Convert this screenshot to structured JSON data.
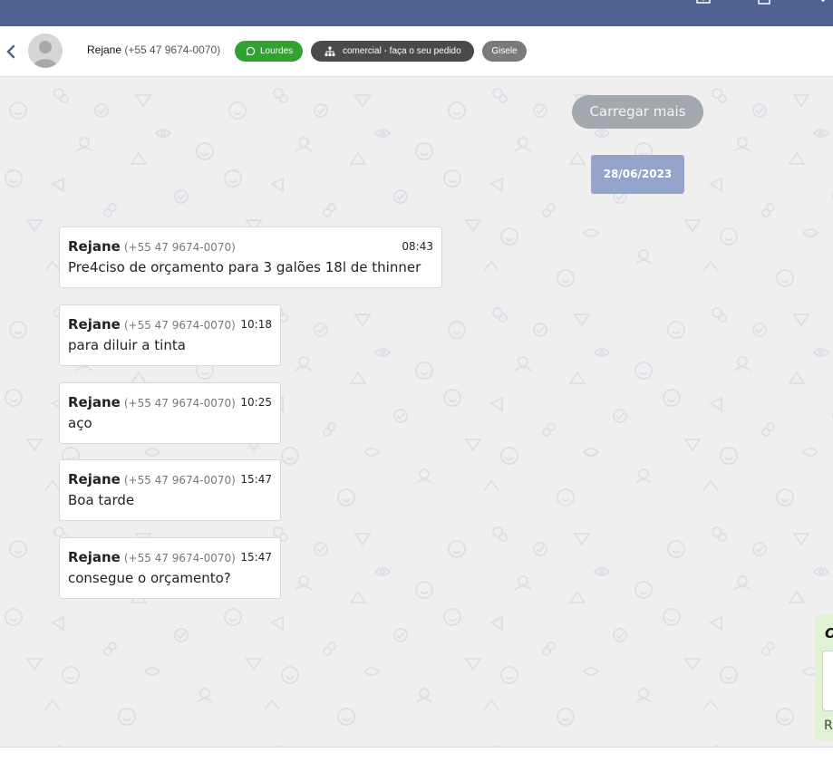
{
  "header": {
    "contact_name": "Rejane",
    "contact_phone": "(+55 47 9674-0070)",
    "tags": {
      "whatsapp": "Lourdes",
      "department": "comercial - faça o seu pedido",
      "user": "Gisele"
    }
  },
  "chat": {
    "load_more": "Carregar mais",
    "date": "28/06/2023",
    "messages": [
      {
        "sender": "Rejane",
        "phone": "(+55 47 9674-0070)",
        "time": "08:43",
        "text": "Pre4ciso de orçamento para 3 galões 18l de thinner"
      },
      {
        "sender": "Rejane",
        "phone": "(+55 47 9674-0070)",
        "time": "10:18",
        "text": "para diluir a tinta"
      },
      {
        "sender": "Rejane",
        "phone": "(+55 47 9674-0070)",
        "time": "10:25",
        "text": "aço"
      },
      {
        "sender": "Rejane",
        "phone": "(+55 47 9674-0070)",
        "time": "15:47",
        "text": "Boa tarde"
      },
      {
        "sender": "Rejane",
        "phone": "(+55 47 9674-0070)",
        "time": "15:47",
        "text": "consegue o orçamento?"
      }
    ]
  },
  "side_panel": {
    "title_initial": "O",
    "footer_initial": "R"
  },
  "colors": {
    "topbar": "#4f6391",
    "whatsapp_tag": "#2fa22f",
    "department_tag": "#4a4a4a",
    "user_tag": "#7a7a7a",
    "date_badge": "#93a3c9",
    "load_more": "#a3a7ae",
    "chat_background": "#efefef"
  },
  "icons": {
    "back": "chevron-left-icon",
    "whatsapp": "whatsapp-icon",
    "department": "sitemap-icon"
  }
}
